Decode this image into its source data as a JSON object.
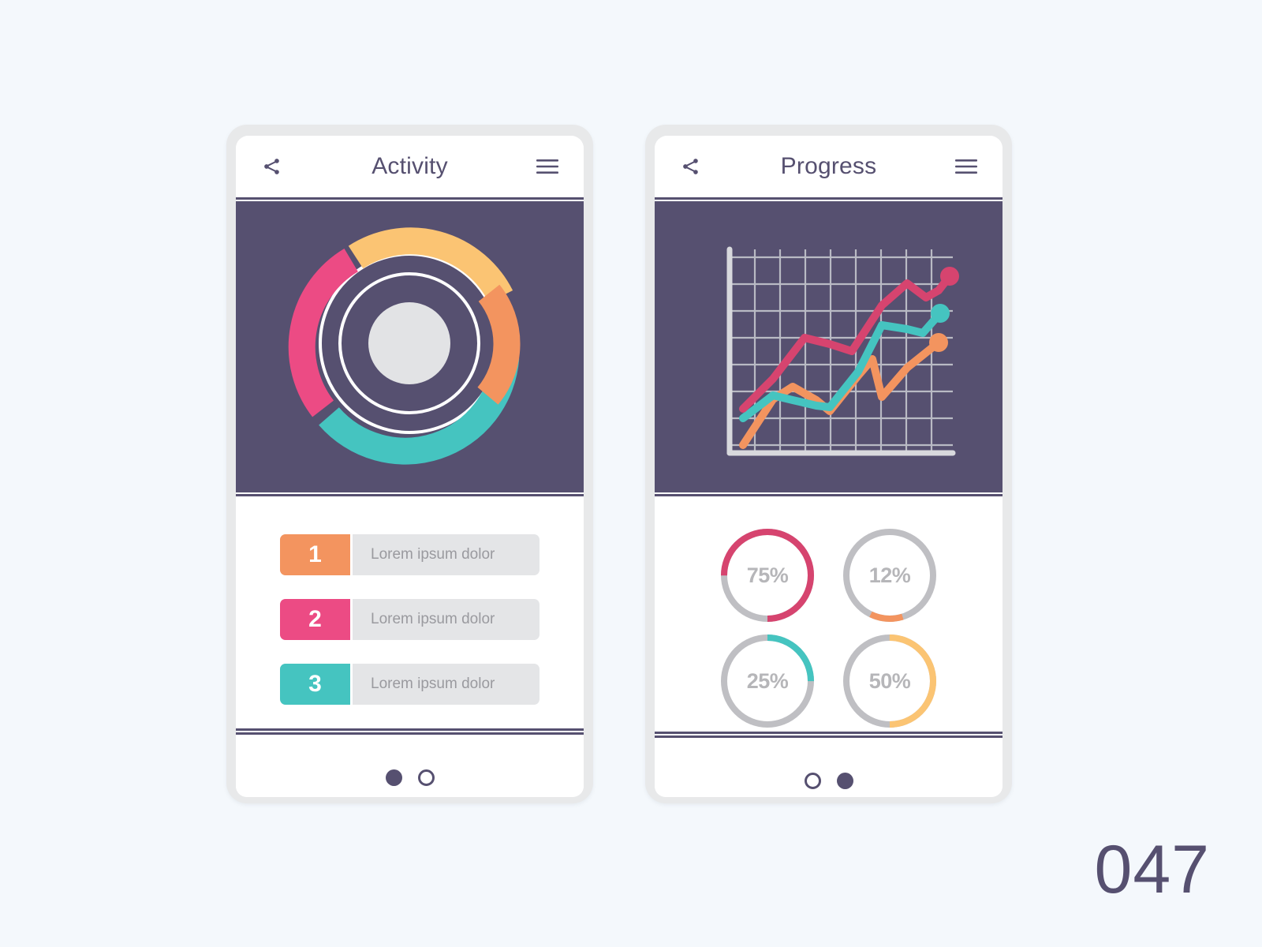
{
  "canvas": {
    "background": "#f4f8fc",
    "page_number": "047"
  },
  "palette": {
    "dark": "#565070",
    "orange": "#f3945f",
    "pink": "#ec4b84",
    "teal": "#45c4c0",
    "yellow": "#fbc473",
    "gray_track": "#bfbfc3",
    "light_gray": "#e4e5e7",
    "white": "#ffffff"
  },
  "screens": [
    {
      "id": "activity",
      "topbar": {
        "title": "Activity",
        "share_icon": "share-icon",
        "menu_icon": "hamburger-menu-icon"
      },
      "hero": {
        "type": "donut-chart",
        "center_color": "#e2e3e5"
      },
      "list": [
        {
          "number": "1",
          "label": "Lorem ipsum dolor",
          "color": "#f3945f"
        },
        {
          "number": "2",
          "label": "Lorem ipsum dolor",
          "color": "#ec4b84"
        },
        {
          "number": "3",
          "label": "Lorem ipsum dolor",
          "color": "#45c4c0"
        }
      ],
      "pager": {
        "active_index": 0,
        "count": 2
      }
    },
    {
      "id": "progress",
      "topbar": {
        "title": "Progress",
        "share_icon": "share-icon",
        "menu_icon": "hamburger-menu-icon"
      },
      "hero": {
        "type": "line-chart"
      },
      "gauges": [
        {
          "label": "75%",
          "value": 75,
          "color": "#d6446f"
        },
        {
          "label": "12%",
          "value": 12,
          "color": "#f3945f"
        },
        {
          "label": "25%",
          "value": 25,
          "color": "#45c4c0"
        },
        {
          "label": "50%",
          "value": 50,
          "color": "#fbc473"
        }
      ],
      "pager": {
        "active_index": 1,
        "count": 2
      }
    }
  ],
  "chart_data": [
    {
      "type": "pie",
      "title": "Activity donut chart",
      "chart_style": "two-concentric-rings",
      "outer_ring": {
        "segments": [
          {
            "name": "yellow",
            "color": "#fbc473",
            "value": 17,
            "start_deg": 287,
            "end_deg": 349
          },
          {
            "name": "teal",
            "color": "#45c4c0",
            "value": 43,
            "start_deg": 33,
            "end_deg": 189
          },
          {
            "name": "pink",
            "color": "#ec4b84",
            "value": 23,
            "start_deg": 205,
            "end_deg": 287
          }
        ],
        "gap_ranges_deg": [
          [
            349,
            33
          ],
          [
            189,
            205
          ]
        ]
      },
      "inner_ring": {
        "segments": [
          {
            "name": "orange",
            "color": "#f3945f",
            "value": 17,
            "start_deg": 352,
            "end_deg": 62
          }
        ]
      },
      "guide_rings": {
        "color": "#ffffff",
        "count": 2
      },
      "center_disc": {
        "color": "#e2e3e5"
      },
      "legend": [
        "1 Lorem ipsum dolor",
        "2 Lorem ipsum dolor",
        "3 Lorem ipsum dolor"
      ]
    },
    {
      "type": "line",
      "title": "Progress line chart",
      "grid": true,
      "grid_color": "#bfc0c9",
      "axis_color": "#d8d9dd",
      "background": "#565070",
      "xlabel": "",
      "ylabel": "",
      "xlim": [
        0,
        10
      ],
      "ylim": [
        0,
        10
      ],
      "x": [
        0,
        1,
        2,
        3,
        4,
        5,
        6,
        7,
        8,
        9
      ],
      "series": [
        {
          "name": "pink",
          "color": "#d6446f",
          "marker": "dot-end",
          "values": [
            1.8,
            2.6,
            5.6,
            5.2,
            4.8,
            7.3,
            8.8,
            8.0,
            7.4,
            8.7
          ]
        },
        {
          "name": "teal",
          "color": "#45c4c0",
          "marker": "dot-end",
          "values": [
            1.4,
            2.3,
            2.0,
            1.7,
            1.7,
            3.6,
            5.8,
            5.5,
            5.3,
            6.7
          ]
        },
        {
          "name": "orange",
          "color": "#f3945f",
          "marker": "dot-end",
          "values": [
            0.3,
            0.9,
            2.1,
            1.7,
            1.4,
            3.0,
            3.5,
            1.9,
            3.4,
            4.7
          ]
        }
      ]
    },
    {
      "type": "pie",
      "chart_style": "gauge-ring-set",
      "title": "Progress gauges",
      "categories": [
        "75%",
        "12%",
        "25%",
        "50%"
      ],
      "values": [
        75,
        12,
        25,
        50
      ],
      "colors": [
        "#d6446f",
        "#f3945f",
        "#45c4c0",
        "#fbc473"
      ],
      "track_color": "#bfbfc3"
    }
  ]
}
